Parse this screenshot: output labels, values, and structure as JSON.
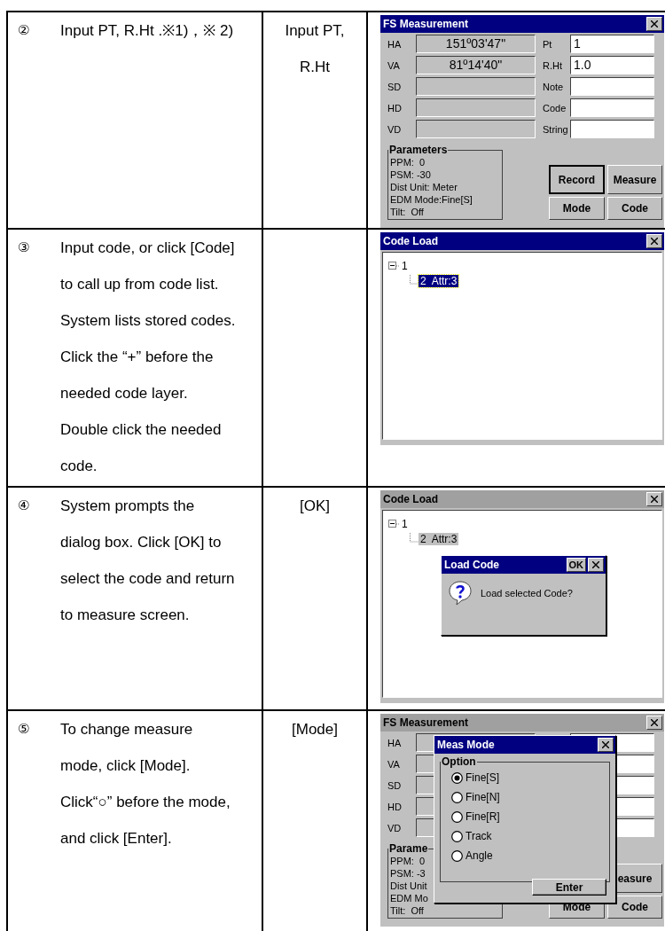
{
  "rows": [
    {
      "step": "②",
      "instruction": "Input PT, R.Ht .※1)，※ 2)",
      "key": "Input PT, R.Ht",
      "screen": {
        "kind": "measure",
        "title": "FS Measurement",
        "active": true,
        "left_fields": [
          {
            "label": "HA",
            "value": "151º03'47\""
          },
          {
            "label": "VA",
            "value": "81º14'40\""
          },
          {
            "label": "SD"
          },
          {
            "label": "HD"
          },
          {
            "label": "VD"
          }
        ],
        "right_fields": [
          {
            "label": "Pt",
            "value": "1"
          },
          {
            "label": "R.Ht",
            "value": "1.0"
          },
          {
            "label": "Note"
          },
          {
            "label": "Code"
          },
          {
            "label": "String"
          }
        ],
        "group_title": "Parameters",
        "parameters": [
          "PPM:  0",
          "PSM: -30",
          "Dist Unit: Meter",
          "EDM Mode:Fine[S]",
          "Tilt:  Off"
        ],
        "buttons": [
          {
            "label": "Record",
            "default": true
          },
          {
            "label": "Measure",
            "default": false
          },
          {
            "label": "Mode",
            "default": false
          },
          {
            "label": "Code",
            "default": false
          }
        ]
      }
    },
    {
      "step": "③",
      "instruction": "Input code, or click [Code] to call up from code list. System lists stored codes. Click the “+” before the needed code layer. Double click the needed code.",
      "screen": {
        "kind": "code_load",
        "title": "Code Load",
        "active": true,
        "tree": [
          {
            "label": "1",
            "selected": false,
            "expanded": true,
            "children": [
              {
                "label": "2  Attr:3",
                "selected": true
              }
            ]
          }
        ]
      }
    },
    {
      "step": "④",
      "instruction": "System prompts the dialog box. Click [OK] to select the code and return to measure screen.",
      "key": "[OK]",
      "screen": {
        "kind": "code_load",
        "title": "Code Load",
        "active": false,
        "tree": [
          {
            "label": "1",
            "selected": false,
            "expanded": true,
            "children": [
              {
                "label": "2  Attr:3",
                "selected": true
              }
            ]
          }
        ],
        "dialog": {
          "kind": "prompt",
          "title": "Load Code",
          "ok": "OK",
          "message": "Load selected Code?"
        }
      }
    },
    {
      "step": "⑤",
      "instruction": "To change measure mode, click [Mode]. Click“○” before the mode, and click [Enter].",
      "key": "[Mode]",
      "screen": {
        "kind": "measure",
        "title": "FS Measurement",
        "active": false,
        "left_fields": [
          {
            "label": "HA"
          },
          {
            "label": "VA"
          },
          {
            "label": "SD"
          },
          {
            "label": "HD"
          },
          {
            "label": "VD"
          }
        ],
        "group_title": "Parame",
        "parameters": [
          "PPM:  0",
          "PSM: -3",
          "Dist Unit",
          "EDM Mo",
          "Tilt:  Off"
        ],
        "buttons": [
          {
            "label": "easure",
            "default": false
          },
          {
            "label": "Mode",
            "default": false
          },
          {
            "label": "Code",
            "default": false
          }
        ],
        "dialog": {
          "kind": "options",
          "title": "Meas Mode",
          "group_title": "Option",
          "options": [
            {
              "label": "Fine[S]",
              "selected": true
            },
            {
              "label": "Fine[N]",
              "selected": false
            },
            {
              "label": "Fine[R]",
              "selected": false
            },
            {
              "label": "Track",
              "selected": false
            },
            {
              "label": "Angle",
              "selected": false
            }
          ],
          "button": "Enter"
        }
      }
    }
  ]
}
